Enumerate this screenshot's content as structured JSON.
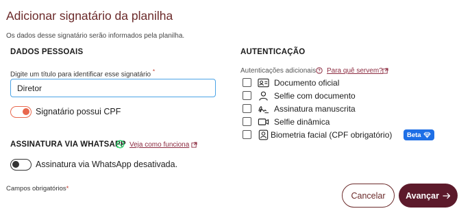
{
  "header": {
    "title": "Adicionar signatário da planilha",
    "subtitle": "Os dados desse signatário serão informados pela planilha."
  },
  "personal": {
    "heading": "DADOS PESSOAIS",
    "title_label": "Digite um título para identificar esse signatário",
    "required_mark": "*",
    "title_value": "Diretor",
    "cpf_toggle_label": "Signatário possui CPF",
    "cpf_toggle_on": true
  },
  "whatsapp": {
    "heading": "ASSINATURA VIA WHATSAPP",
    "link_text": "Veja como funciona",
    "toggle_label": "Assinatura via WhatsApp desativada.",
    "toggle_on": false
  },
  "auth": {
    "heading": "AUTENTICAÇÃO",
    "additional_label": "Autenticações adicionais",
    "why_link": "Para quê servem?",
    "options": [
      {
        "label": "Documento oficial",
        "icon": "id-card-icon",
        "checked": false
      },
      {
        "label": "Selfie com documento",
        "icon": "person-icon",
        "checked": false
      },
      {
        "label": "Assinatura manuscrita",
        "icon": "signature-icon",
        "checked": false
      },
      {
        "label": "Selfie dinâmica",
        "icon": "video-icon",
        "checked": false
      },
      {
        "label": "Biometria facial (CPF obrigatório)",
        "icon": "face-id-icon",
        "checked": false
      }
    ],
    "beta_label": "Beta"
  },
  "footer": {
    "required_note": "Campos obrigatórios",
    "required_mark": "*",
    "cancel_label": "Cancelar",
    "next_label": "Avançar"
  },
  "colors": {
    "title": "#6b2a2a",
    "accent_toggle": "#e8674d",
    "input_focus": "#4aa3e6",
    "primary_button": "#5c1a2b",
    "beta_badge": "#1e6fe6",
    "link": "#8b2a3f",
    "whatsapp": "#25d366"
  }
}
